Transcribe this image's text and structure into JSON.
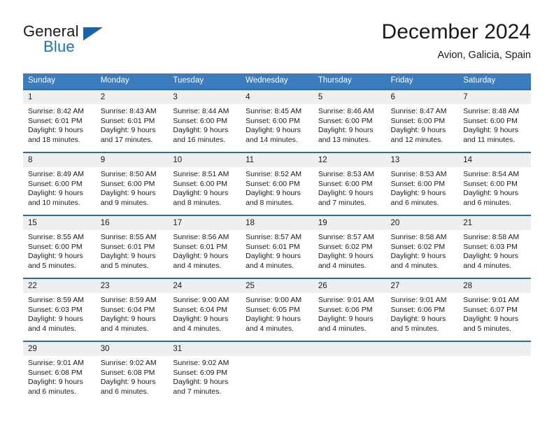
{
  "brand": {
    "name_part1": "General",
    "name_part2": "Blue",
    "logo_icon": "triangle-flag-icon",
    "accent_color": "#1077bd"
  },
  "header": {
    "title": "December 2024",
    "subtitle": "Avion, Galicia, Spain"
  },
  "theme": {
    "header_row_bg": "#3a7cbe",
    "cell_border": "#2e6aa8",
    "daynum_bg": "#efefef",
    "page_bg": "#ffffff"
  },
  "weekdays": [
    "Sunday",
    "Monday",
    "Tuesday",
    "Wednesday",
    "Thursday",
    "Friday",
    "Saturday"
  ],
  "labels": {
    "sunrise_prefix": "Sunrise:",
    "sunset_prefix": "Sunset:",
    "daylight_prefix": "Daylight:"
  },
  "weeks": [
    [
      {
        "day": "1",
        "sunrise": "Sunrise: 8:42 AM",
        "sunset": "Sunset: 6:01 PM",
        "daylight1": "Daylight: 9 hours",
        "daylight2": "and 18 minutes."
      },
      {
        "day": "2",
        "sunrise": "Sunrise: 8:43 AM",
        "sunset": "Sunset: 6:01 PM",
        "daylight1": "Daylight: 9 hours",
        "daylight2": "and 17 minutes."
      },
      {
        "day": "3",
        "sunrise": "Sunrise: 8:44 AM",
        "sunset": "Sunset: 6:00 PM",
        "daylight1": "Daylight: 9 hours",
        "daylight2": "and 16 minutes."
      },
      {
        "day": "4",
        "sunrise": "Sunrise: 8:45 AM",
        "sunset": "Sunset: 6:00 PM",
        "daylight1": "Daylight: 9 hours",
        "daylight2": "and 14 minutes."
      },
      {
        "day": "5",
        "sunrise": "Sunrise: 8:46 AM",
        "sunset": "Sunset: 6:00 PM",
        "daylight1": "Daylight: 9 hours",
        "daylight2": "and 13 minutes."
      },
      {
        "day": "6",
        "sunrise": "Sunrise: 8:47 AM",
        "sunset": "Sunset: 6:00 PM",
        "daylight1": "Daylight: 9 hours",
        "daylight2": "and 12 minutes."
      },
      {
        "day": "7",
        "sunrise": "Sunrise: 8:48 AM",
        "sunset": "Sunset: 6:00 PM",
        "daylight1": "Daylight: 9 hours",
        "daylight2": "and 11 minutes."
      }
    ],
    [
      {
        "day": "8",
        "sunrise": "Sunrise: 8:49 AM",
        "sunset": "Sunset: 6:00 PM",
        "daylight1": "Daylight: 9 hours",
        "daylight2": "and 10 minutes."
      },
      {
        "day": "9",
        "sunrise": "Sunrise: 8:50 AM",
        "sunset": "Sunset: 6:00 PM",
        "daylight1": "Daylight: 9 hours",
        "daylight2": "and 9 minutes."
      },
      {
        "day": "10",
        "sunrise": "Sunrise: 8:51 AM",
        "sunset": "Sunset: 6:00 PM",
        "daylight1": "Daylight: 9 hours",
        "daylight2": "and 8 minutes."
      },
      {
        "day": "11",
        "sunrise": "Sunrise: 8:52 AM",
        "sunset": "Sunset: 6:00 PM",
        "daylight1": "Daylight: 9 hours",
        "daylight2": "and 8 minutes."
      },
      {
        "day": "12",
        "sunrise": "Sunrise: 8:53 AM",
        "sunset": "Sunset: 6:00 PM",
        "daylight1": "Daylight: 9 hours",
        "daylight2": "and 7 minutes."
      },
      {
        "day": "13",
        "sunrise": "Sunrise: 8:53 AM",
        "sunset": "Sunset: 6:00 PM",
        "daylight1": "Daylight: 9 hours",
        "daylight2": "and 6 minutes."
      },
      {
        "day": "14",
        "sunrise": "Sunrise: 8:54 AM",
        "sunset": "Sunset: 6:00 PM",
        "daylight1": "Daylight: 9 hours",
        "daylight2": "and 6 minutes."
      }
    ],
    [
      {
        "day": "15",
        "sunrise": "Sunrise: 8:55 AM",
        "sunset": "Sunset: 6:00 PM",
        "daylight1": "Daylight: 9 hours",
        "daylight2": "and 5 minutes."
      },
      {
        "day": "16",
        "sunrise": "Sunrise: 8:55 AM",
        "sunset": "Sunset: 6:01 PM",
        "daylight1": "Daylight: 9 hours",
        "daylight2": "and 5 minutes."
      },
      {
        "day": "17",
        "sunrise": "Sunrise: 8:56 AM",
        "sunset": "Sunset: 6:01 PM",
        "daylight1": "Daylight: 9 hours",
        "daylight2": "and 4 minutes."
      },
      {
        "day": "18",
        "sunrise": "Sunrise: 8:57 AM",
        "sunset": "Sunset: 6:01 PM",
        "daylight1": "Daylight: 9 hours",
        "daylight2": "and 4 minutes."
      },
      {
        "day": "19",
        "sunrise": "Sunrise: 8:57 AM",
        "sunset": "Sunset: 6:02 PM",
        "daylight1": "Daylight: 9 hours",
        "daylight2": "and 4 minutes."
      },
      {
        "day": "20",
        "sunrise": "Sunrise: 8:58 AM",
        "sunset": "Sunset: 6:02 PM",
        "daylight1": "Daylight: 9 hours",
        "daylight2": "and 4 minutes."
      },
      {
        "day": "21",
        "sunrise": "Sunrise: 8:58 AM",
        "sunset": "Sunset: 6:03 PM",
        "daylight1": "Daylight: 9 hours",
        "daylight2": "and 4 minutes."
      }
    ],
    [
      {
        "day": "22",
        "sunrise": "Sunrise: 8:59 AM",
        "sunset": "Sunset: 6:03 PM",
        "daylight1": "Daylight: 9 hours",
        "daylight2": "and 4 minutes."
      },
      {
        "day": "23",
        "sunrise": "Sunrise: 8:59 AM",
        "sunset": "Sunset: 6:04 PM",
        "daylight1": "Daylight: 9 hours",
        "daylight2": "and 4 minutes."
      },
      {
        "day": "24",
        "sunrise": "Sunrise: 9:00 AM",
        "sunset": "Sunset: 6:04 PM",
        "daylight1": "Daylight: 9 hours",
        "daylight2": "and 4 minutes."
      },
      {
        "day": "25",
        "sunrise": "Sunrise: 9:00 AM",
        "sunset": "Sunset: 6:05 PM",
        "daylight1": "Daylight: 9 hours",
        "daylight2": "and 4 minutes."
      },
      {
        "day": "26",
        "sunrise": "Sunrise: 9:01 AM",
        "sunset": "Sunset: 6:06 PM",
        "daylight1": "Daylight: 9 hours",
        "daylight2": "and 4 minutes."
      },
      {
        "day": "27",
        "sunrise": "Sunrise: 9:01 AM",
        "sunset": "Sunset: 6:06 PM",
        "daylight1": "Daylight: 9 hours",
        "daylight2": "and 5 minutes."
      },
      {
        "day": "28",
        "sunrise": "Sunrise: 9:01 AM",
        "sunset": "Sunset: 6:07 PM",
        "daylight1": "Daylight: 9 hours",
        "daylight2": "and 5 minutes."
      }
    ],
    [
      {
        "day": "29",
        "sunrise": "Sunrise: 9:01 AM",
        "sunset": "Sunset: 6:08 PM",
        "daylight1": "Daylight: 9 hours",
        "daylight2": "and 6 minutes."
      },
      {
        "day": "30",
        "sunrise": "Sunrise: 9:02 AM",
        "sunset": "Sunset: 6:08 PM",
        "daylight1": "Daylight: 9 hours",
        "daylight2": "and 6 minutes."
      },
      {
        "day": "31",
        "sunrise": "Sunrise: 9:02 AM",
        "sunset": "Sunset: 6:09 PM",
        "daylight1": "Daylight: 9 hours",
        "daylight2": "and 7 minutes."
      },
      {
        "day": "",
        "sunrise": "",
        "sunset": "",
        "daylight1": "",
        "daylight2": ""
      },
      {
        "day": "",
        "sunrise": "",
        "sunset": "",
        "daylight1": "",
        "daylight2": ""
      },
      {
        "day": "",
        "sunrise": "",
        "sunset": "",
        "daylight1": "",
        "daylight2": ""
      },
      {
        "day": "",
        "sunrise": "",
        "sunset": "",
        "daylight1": "",
        "daylight2": ""
      }
    ]
  ]
}
